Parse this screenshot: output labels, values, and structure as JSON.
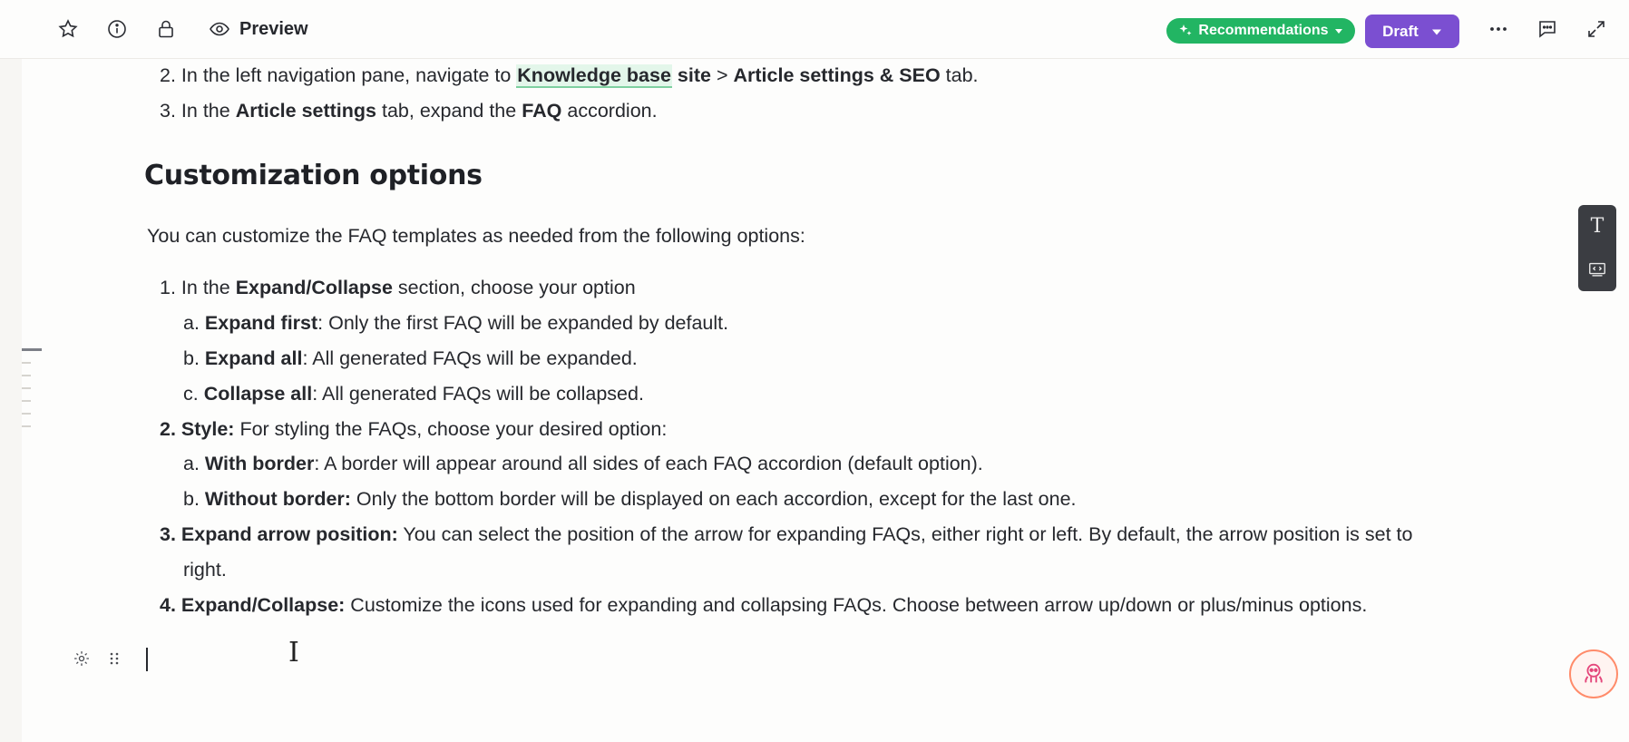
{
  "toolbar": {
    "preview_label": "Preview",
    "recommendations_label": "Recommendations",
    "draft_label": "Draft",
    "icons": [
      "star-icon",
      "info-icon",
      "lock-icon",
      "eye-icon",
      "more-icon",
      "comment-icon",
      "expand-icon"
    ]
  },
  "article": {
    "intro_steps": [
      {
        "num": "2.",
        "pre": "In the left navigation pane, navigate to ",
        "kb": "Knowledge base",
        "site": " site",
        "gt": " > ",
        "b2": "Article settings & SEO",
        "post": " tab."
      },
      {
        "num": "3.",
        "pre": "In the ",
        "b1": "Article settings",
        "mid": " tab, expand the ",
        "b2": "FAQ",
        "post": " accordion."
      }
    ],
    "heading": "Customization options",
    "paragraph": "You can customize the FAQ templates as needed from the following options:",
    "options": {
      "o1": {
        "num": "1.",
        "pre": "In the ",
        "bold": "Expand/Collapse",
        "post": " section, choose your option"
      },
      "o1a": {
        "letter": "a.",
        "bold": "Expand first",
        "post": ": Only the first FAQ will be expanded by default."
      },
      "o1b": {
        "letter": "b.",
        "bold": "Expand all",
        "post": ": All generated FAQs will be expanded."
      },
      "o1c": {
        "letter": "c.",
        "bold": "Collapse all",
        "post": ": All generated FAQs will be collapsed."
      },
      "o2": {
        "num": "2.",
        "bold": "Style:",
        "post": " For styling the FAQs, choose your desired option:"
      },
      "o2a": {
        "letter": "a.",
        "bold": "With border",
        "post": ": A border will appear around all sides of each FAQ accordion (default option)."
      },
      "o2b": {
        "letter": "b.",
        "bold": "Without border:",
        "post": " Only the bottom border will be displayed on each accordion, except for the last one."
      },
      "o3": {
        "num": "3.",
        "bold": "Expand arrow position:",
        "post": " You can select the position of the arrow for expanding FAQs, either right or left. By default, the arrow position is set to",
        "wrap": "right."
      },
      "o4": {
        "num": "4.",
        "bold": "Expand/Collapse:",
        "post": " Customize the icons used for expanding and collapsing FAQs. Choose between arrow up/down or plus/minus options."
      }
    }
  },
  "side_tools": {
    "text_tool_glyph": "T"
  },
  "colors": {
    "recommendations": "#22b563",
    "draft": "#7b4fd1",
    "kb_highlight": "#e3f6ea"
  }
}
